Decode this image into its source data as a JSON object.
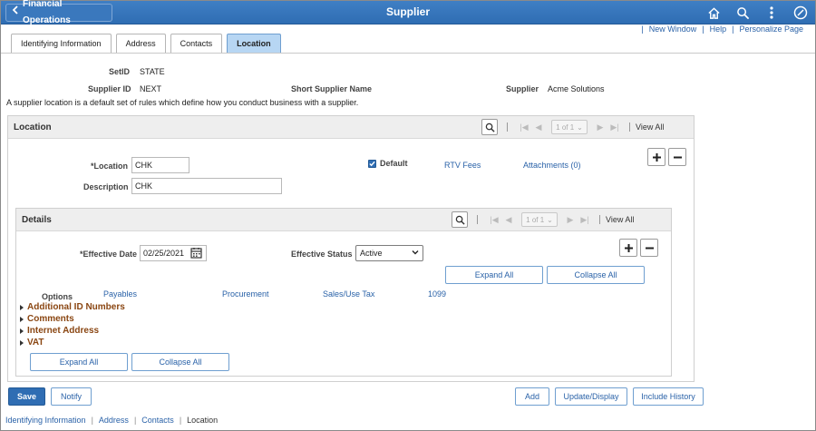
{
  "header": {
    "back_label": "Financial Operations",
    "title": "Supplier"
  },
  "top_links": {
    "new_window": "New Window",
    "help": "Help",
    "personalize": "Personalize Page"
  },
  "tabs": [
    {
      "label": "Identifying Information"
    },
    {
      "label": "Address"
    },
    {
      "label": "Contacts"
    },
    {
      "label": "Location"
    }
  ],
  "info": {
    "setid_label": "SetID",
    "setid_value": "STATE",
    "supplier_id_label": "Supplier ID",
    "supplier_id_value": "NEXT",
    "short_name_label": "Short Supplier Name",
    "supplier_label": "Supplier",
    "supplier_value": "Acme Solutions",
    "description": "A supplier location is a default set of rules which define how you conduct business with a supplier."
  },
  "location_group": {
    "title": "Location",
    "pager": "1 of 1",
    "view_all": "View All",
    "location_label": "*Location",
    "location_value": "CHK",
    "description_label": "Description",
    "description_value": "CHK",
    "default_label": "Default",
    "rtv_fees": "RTV Fees",
    "attachments": "Attachments (0)"
  },
  "details_group": {
    "title": "Details",
    "pager": "1 of 1",
    "view_all": "View All",
    "effective_date_label": "*Effective Date",
    "effective_date_value": "02/25/2021",
    "effective_status_label": "Effective Status",
    "effective_status_value": "Active",
    "expand_all": "Expand All",
    "collapse_all": "Collapse All",
    "options_label": "Options",
    "options": [
      "Payables",
      "Procurement",
      "Sales/Use Tax",
      "1099"
    ],
    "sections": [
      "Additional ID Numbers",
      "Comments",
      "Internet Address",
      "VAT"
    ]
  },
  "bottom_buttons": {
    "save": "Save",
    "notify": "Notify",
    "add": "Add",
    "update_display": "Update/Display",
    "include_history": "Include History"
  },
  "breadcrumbs": [
    "Identifying Information",
    "Address",
    "Contacts",
    "Location"
  ]
}
